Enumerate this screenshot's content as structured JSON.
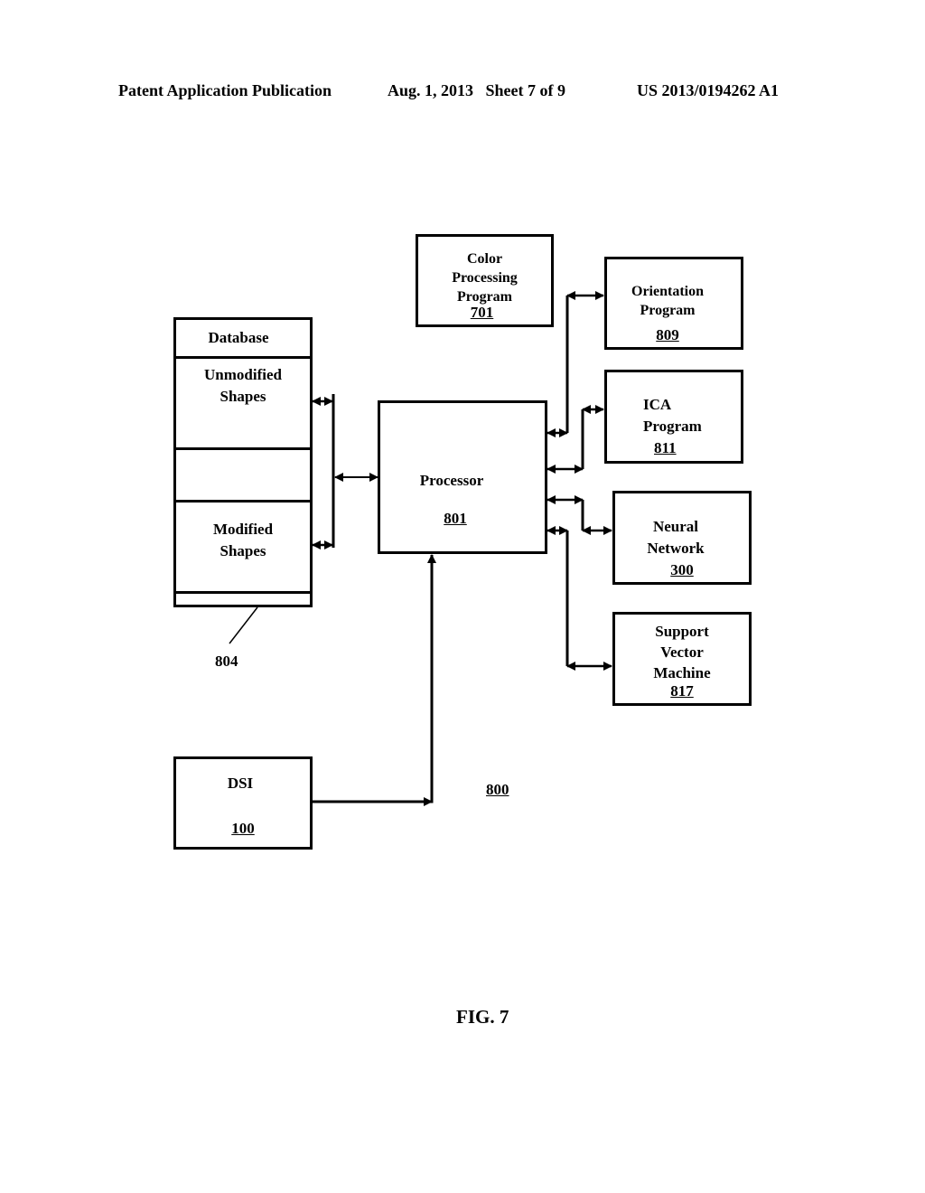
{
  "header": {
    "left": "Patent Application Publication",
    "date_sheet": "Aug. 1, 2013   Sheet 7 of 9",
    "number": "US 2013/0194262 A1"
  },
  "diagram": {
    "system_ref": "800",
    "figure_label": "FIG. 7",
    "database": {
      "title": "Database",
      "sections": [
        {
          "label_line1": "Unmodified",
          "label_line2": "Shapes"
        },
        {
          "label_line1": "",
          "label_line2": ""
        },
        {
          "label_line1": "Modified",
          "label_line2": "Shapes"
        }
      ],
      "ref": "804"
    },
    "processor": {
      "label": "Processor",
      "ref": "801"
    },
    "color_processing": {
      "line1": "Color",
      "line2": "Processing",
      "line3": "Program",
      "ref": "701"
    },
    "orientation": {
      "line1": "Orientation",
      "line2": "Program",
      "ref": "809"
    },
    "ica": {
      "line1": "ICA",
      "line2": "Program",
      "ref": "811"
    },
    "neural_network": {
      "line1": "Neural",
      "line2": "Network",
      "ref": "300"
    },
    "svm": {
      "line1": "Support",
      "line2": "Vector",
      "line3": "Machine",
      "ref": "817"
    },
    "dsi": {
      "label": "DSI",
      "ref": "100"
    }
  }
}
